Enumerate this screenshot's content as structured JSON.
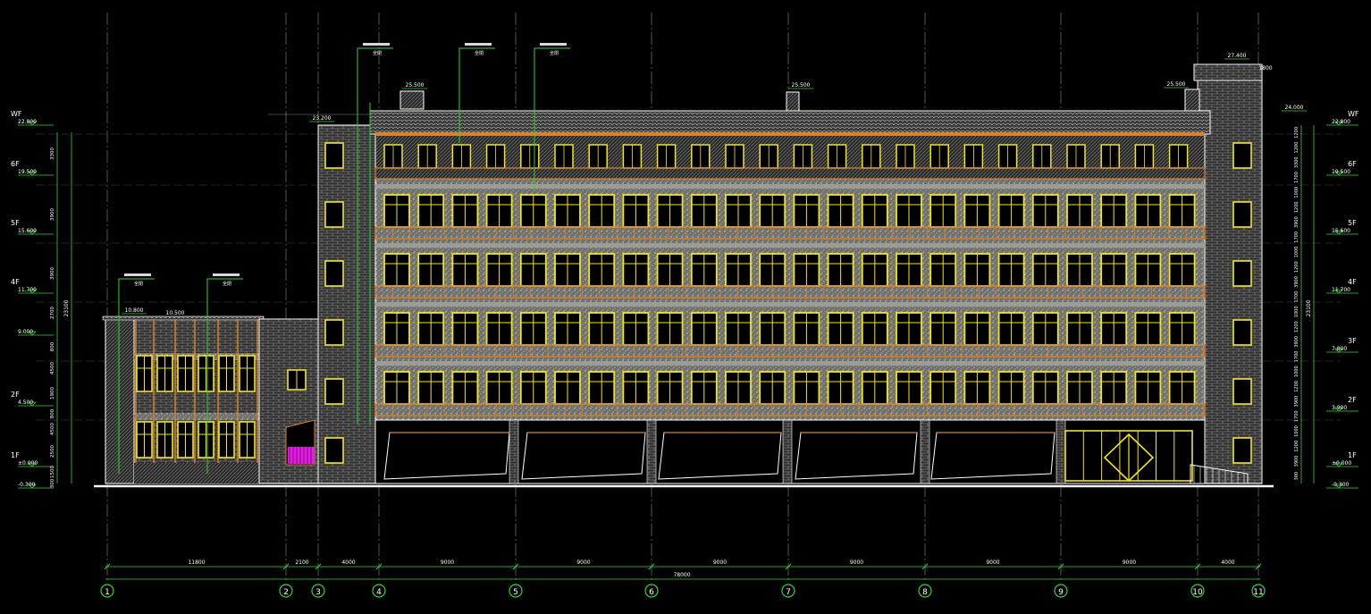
{
  "colors": {
    "background": "#000000",
    "grid_line": "#8c8c8c",
    "dimension": "#2bd82b",
    "building_outline": "#ffffff",
    "window_frame": "#f2e61a",
    "balcony_rail": "#d9822b",
    "stucco": "#8a8a86",
    "brick": "#5a5a5a",
    "magenta": "#e020e0",
    "text": "#ffffff"
  },
  "axes": {
    "labels": [
      "1",
      "2",
      "3",
      "4",
      "5",
      "6",
      "7",
      "8",
      "9",
      "10",
      "11"
    ],
    "spans": [
      "11800",
      "2100",
      "4000",
      "9000",
      "9000",
      "9000",
      "9000",
      "9000",
      "9000",
      "4000"
    ],
    "total": "78000"
  },
  "left_levels": [
    {
      "name": "WF",
      "elev": "22.800"
    },
    {
      "name": "6F",
      "elev": "19.500"
    },
    {
      "name": "5F",
      "elev": "15.600"
    },
    {
      "name": "4F",
      "elev": "11.700"
    },
    {
      "name": "",
      "elev": "9.000"
    },
    {
      "name": "2F",
      "elev": "4.500"
    },
    {
      "name": "1F",
      "elev": "±0.000"
    },
    {
      "name": "",
      "elev": "-0.300"
    }
  ],
  "right_levels": [
    {
      "name": "WF",
      "elev": "22.800"
    },
    {
      "name": "6F",
      "elev": "19.500"
    },
    {
      "name": "5F",
      "elev": "15.600"
    },
    {
      "name": "4F",
      "elev": "11.700"
    },
    {
      "name": "3F",
      "elev": "7.800"
    },
    {
      "name": "2F",
      "elev": "3.900"
    },
    {
      "name": "1F",
      "elev": "±0.000"
    },
    {
      "name": "",
      "elev": "-0.300"
    }
  ],
  "left_dims": [
    "3300",
    "3900",
    "3900",
    "2700",
    "800",
    "4500",
    "1900",
    "800",
    "4500",
    "2500",
    "1500",
    "300"
  ],
  "left_total": "23100",
  "right_dims": [
    "1200",
    "1200",
    "3300",
    "1700",
    "1000",
    "1200",
    "3900",
    "1700",
    "1000",
    "1200",
    "3900",
    "1700",
    "1000",
    "1200",
    "3900",
    "1700",
    "1000",
    "1200",
    "3900",
    "1700",
    "1000",
    "1200",
    "3900",
    "300"
  ],
  "right_total": "23100",
  "roof_marks": [
    "25.500",
    "25.500",
    "25.500",
    "27.400",
    "24.000",
    "23.200",
    "10.800",
    "10.500",
    "1800"
  ],
  "callout_note": "全閉"
}
